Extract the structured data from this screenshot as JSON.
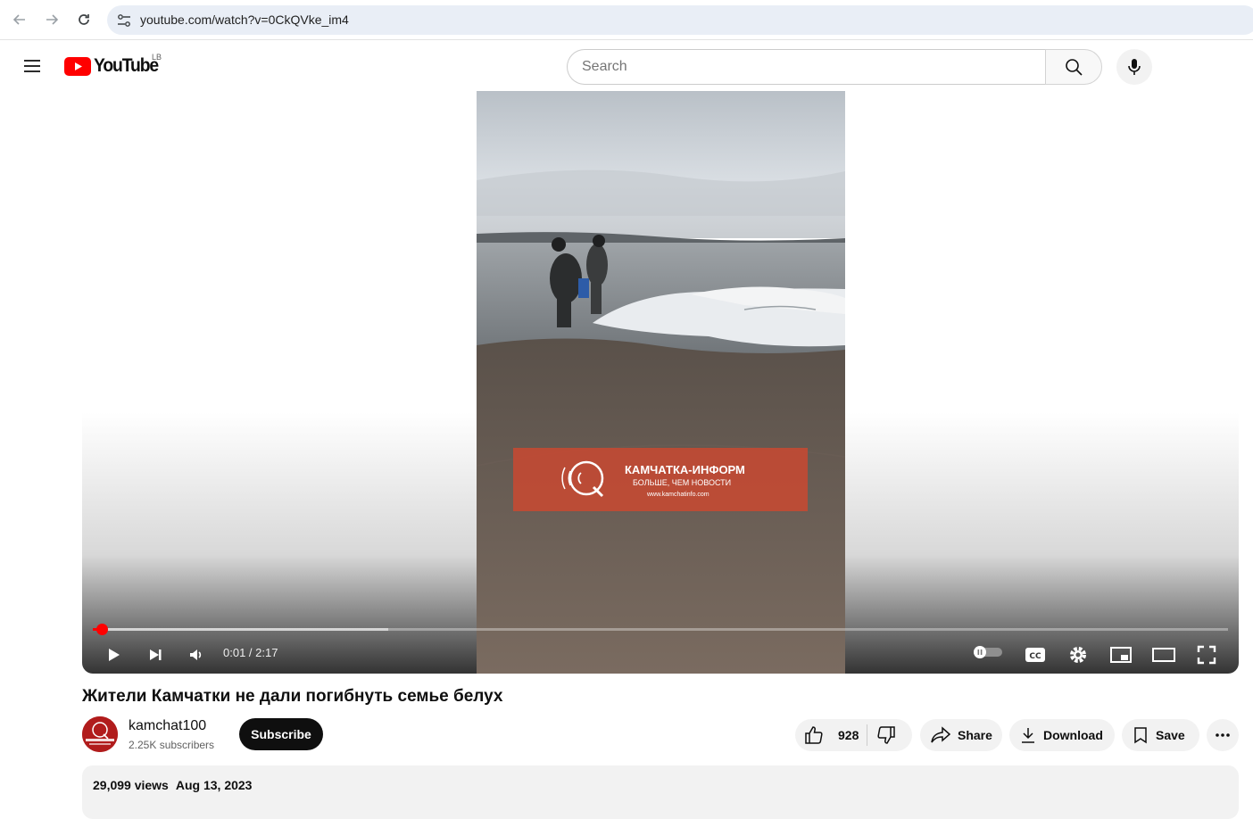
{
  "browser": {
    "url": "youtube.com/watch?v=0CkQVke_im4"
  },
  "masthead": {
    "logo_text": "YouTube",
    "country_code": "LB",
    "search_placeholder": "Search"
  },
  "player": {
    "watermark_title": "КАМЧАТКА-ИНФОРМ",
    "watermark_subtitle": "БОЛЬШЕ, ЧЕМ НОВОСТИ",
    "watermark_site": "www.kamchatinfo.com",
    "time_display": "0:01 / 2:17",
    "progress_fraction": 0.0077,
    "buffer_fraction": 0.26,
    "accent_color": "#ff0000"
  },
  "video": {
    "title": "Жители Камчатки не дали погибнуть семье белух",
    "channel_name": "kamchat100",
    "subscribers": "2.25K subscribers",
    "subscribe_label": "Subscribe",
    "like_count": "928",
    "share_label": "Share",
    "download_label": "Download",
    "save_label": "Save",
    "views": "29,099 views",
    "date": "Aug 13, 2023"
  }
}
